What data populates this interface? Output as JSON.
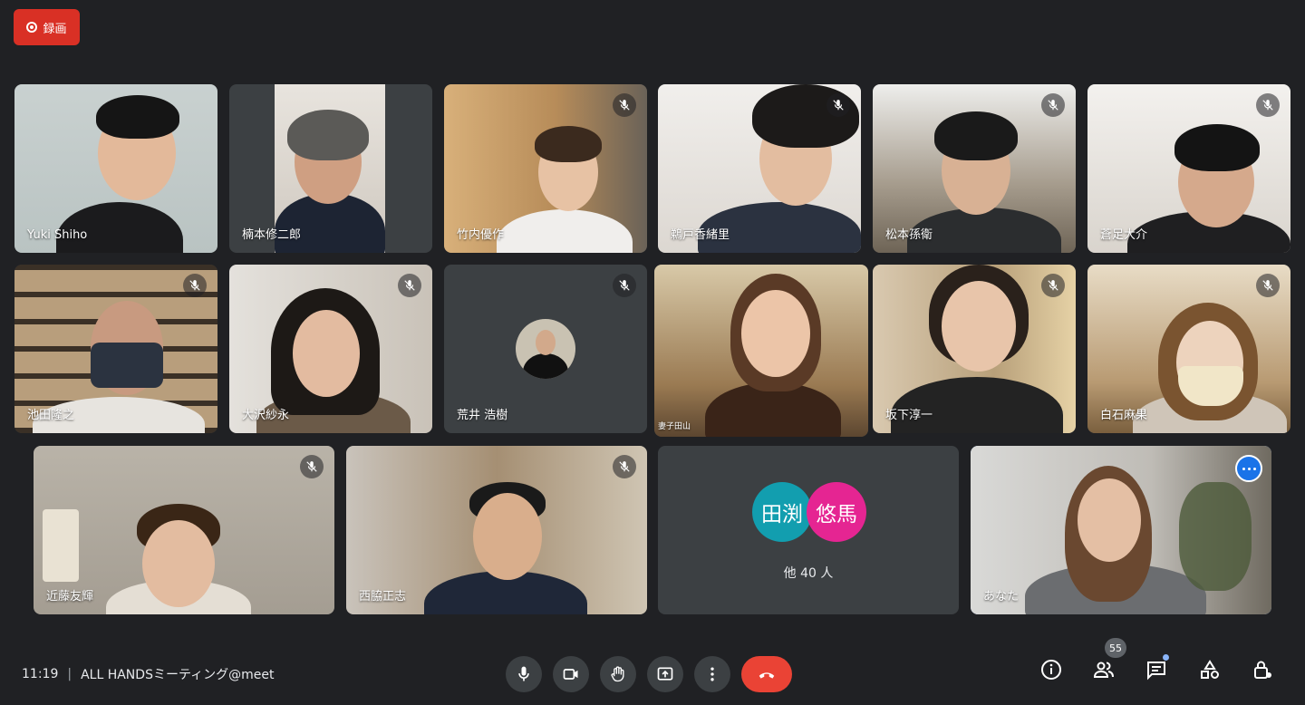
{
  "recording": {
    "label": "録画"
  },
  "participants": [
    {
      "id": "p1",
      "name": "Yuki Shiho",
      "muted": false
    },
    {
      "id": "p2",
      "name": "楠本修二郎",
      "muted": false
    },
    {
      "id": "p3",
      "name": "竹内優作",
      "muted": true
    },
    {
      "id": "p4",
      "name": "鵜戸香緒里",
      "muted": true
    },
    {
      "id": "p5",
      "name": "松本孫衛",
      "muted": true
    },
    {
      "id": "p6",
      "name": "蒼足大介",
      "muted": true
    },
    {
      "id": "p7",
      "name": "池田隆之",
      "muted": true
    },
    {
      "id": "p8",
      "name": "大沢紗永",
      "muted": true
    },
    {
      "id": "p9",
      "name": "荒井 浩樹",
      "muted": true
    },
    {
      "id": "p10",
      "name": "",
      "muted": false,
      "caption": "妻子田山"
    },
    {
      "id": "p11",
      "name": "坂下淳一",
      "muted": true
    },
    {
      "id": "p12",
      "name": "白石麻果",
      "muted": true
    },
    {
      "id": "p13",
      "name": "近藤友輝",
      "muted": true
    },
    {
      "id": "p14",
      "name": "西脇正志",
      "muted": true
    },
    {
      "id": "p15",
      "name": "あなた",
      "muted": false,
      "self": true
    }
  ],
  "others": {
    "avatars": [
      {
        "text": "田渕",
        "color": "#129eaf"
      },
      {
        "text": "悠馬",
        "color": "#e52592"
      }
    ],
    "label": "他 40 人"
  },
  "footer": {
    "time": "11:19",
    "separator": "|",
    "meeting_title": "ALL HANDSミーティング@meet",
    "controls": [
      "mic-button",
      "camera-button",
      "raise-hand-button",
      "present-button",
      "more-options-button",
      "end-call-button"
    ],
    "people_count": "55"
  },
  "colors": {
    "background": "#202124",
    "end_call": "#ea4335",
    "record": "#d93025",
    "self_outline": "#8ab4f8"
  }
}
